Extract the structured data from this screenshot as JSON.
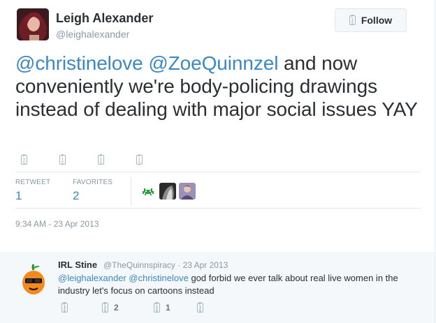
{
  "tweet": {
    "author_name": "Leigh Alexander",
    "author_handle": "@leighalexander",
    "follow_label": "Follow",
    "text_parts": [
      {
        "t": "@christinelove",
        "mention": true
      },
      {
        "t": " ",
        "mention": false
      },
      {
        "t": "@ZoeQuinnzel",
        "mention": true
      },
      {
        "t": " and now conveniently we're body-policing drawings instead of dealing with major social issues YAY",
        "mention": false
      }
    ],
    "stats": {
      "retweets_label": "RETWEET",
      "retweets_count": "1",
      "favorites_label": "FAVORITES",
      "favorites_count": "2"
    },
    "timestamp": "9:34 AM - 23 Apr 2013"
  },
  "reply": {
    "author_name": "IRL Stine",
    "author_handle": "@TheQuinnspiracy",
    "sep": "·",
    "date": "23 Apr 2013",
    "text_parts": [
      {
        "t": "@leighalexander",
        "mention": true
      },
      {
        "t": " ",
        "mention": false
      },
      {
        "t": "@christinelove",
        "mention": true
      },
      {
        "t": " god forbid we ever talk about real live women in the industry let's focus on cartoons instead",
        "mention": false
      }
    ],
    "retweet_count": "2",
    "favorite_count": "1"
  },
  "icon_glyph": [
    "F",
    "1",
    "5"
  ],
  "colors": {
    "mention": "#3b88c3",
    "muted": "#8899a6",
    "text": "#292f33"
  }
}
